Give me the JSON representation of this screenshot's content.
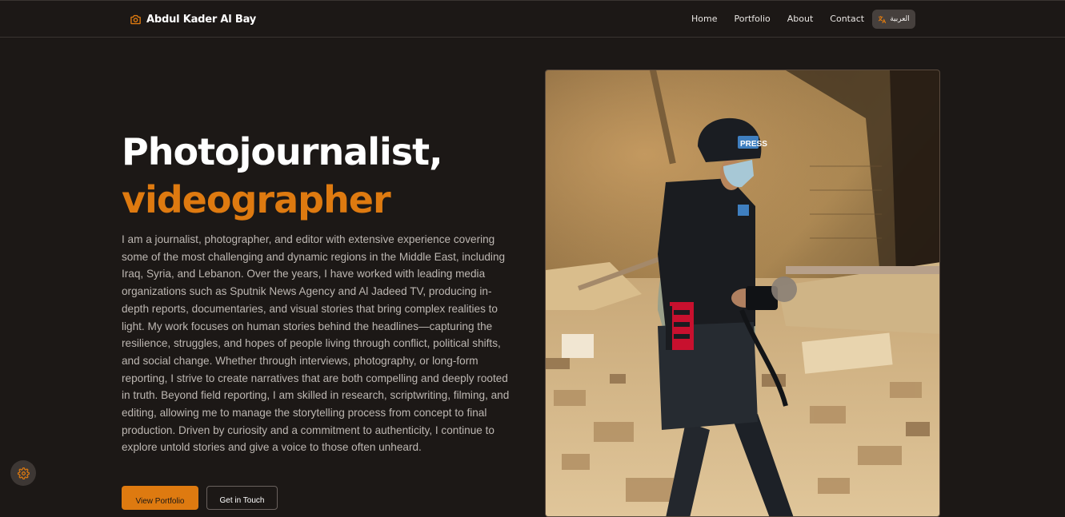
{
  "brand": {
    "name": "Abdul Kader Al Bay",
    "icon": "camera-icon"
  },
  "nav": {
    "items": [
      {
        "label": "Home"
      },
      {
        "label": "Portfolio"
      },
      {
        "label": "About"
      },
      {
        "label": "Contact"
      }
    ],
    "language_button": {
      "label": "العربية",
      "icon": "translate-icon"
    }
  },
  "hero": {
    "title_line1": "Photojournalist,",
    "title_line2": "videographer",
    "bio": "I am a journalist, photographer, and editor with extensive experience covering some of the most challenging and dynamic regions in the Middle East, including Iraq, Syria, and Lebanon. Over the years, I have worked with leading media organizations such as Sputnik News Agency and Al Jadeed TV, producing in-depth reports, documentaries, and visual stories that bring complex realities to light. My work focuses on human stories behind the headlines—capturing the resilience, struggles, and hopes of people living through conflict, political shifts, and social change. Whether through interviews, photography, or long-form reporting, I strive to create narratives that are both compelling and deeply rooted in truth. Beyond field reporting, I am skilled in research, scriptwriting, filming, and editing, allowing me to manage the storytelling process from concept to final production. Driven by curiosity and a commitment to authenticity, I continue to explore untold stories and give a voice to those often unheard.",
    "primary_button": "View Portfolio",
    "secondary_button": "Get in Touch",
    "vest_label": "PRESS"
  },
  "settings_fab": {
    "icon": "gear-icon"
  },
  "colors": {
    "background": "#1c1816",
    "accent": "#de7a10",
    "text": "#ffffff",
    "muted_text": "#bdb7b2"
  }
}
